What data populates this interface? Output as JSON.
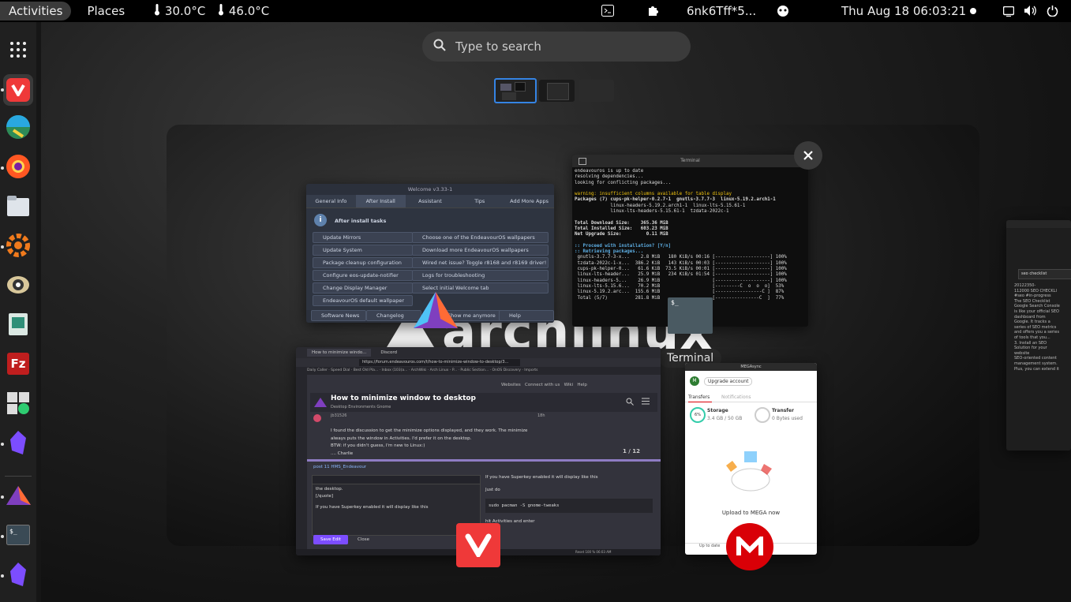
{
  "topbar": {
    "activities": "Activities",
    "places": "Places",
    "temp1": "30.0°C",
    "temp2": "46.0°C",
    "window_title": "6nk6Tff*5...",
    "datetime": "Thu Aug 18  06:03:21"
  },
  "search": {
    "placeholder": "Type to search"
  },
  "icons": [
    "apps-grid-icon",
    "vivaldi-icon",
    "kvantum-icon",
    "firefox-icon",
    "files-icon",
    "settings-icon",
    "eye-icon",
    "notes-icon",
    "filezilla-icon",
    "calculator-icon",
    "obsidian-icon",
    "endeavour-icon",
    "terminal-icon",
    "obsidian-icon"
  ],
  "windows": {
    "terminal_label": "Terminal",
    "terminal": {
      "title": "Terminal",
      "lines": [
        "endeavouros is up to date",
        "resolving dependencies...",
        "looking for conflicting packages...",
        "",
        "warning: insufficient columns available for table display",
        "Packages (7) cups-pk-helper-0.2.7-1  gnutls-3.7.7-3  linux-5.19.2.arch1-1",
        "             linux-headers-5.19.2.arch1-1  linux-lts-5.15.61-1",
        "             linux-lts-headers-5.15.61-1  tzdata-2022c-1",
        "",
        "Total Download Size:    365.36 MiB",
        "Total Installed Size:   603.23 MiB",
        "Net Upgrade Size:         0.11 MiB",
        "",
        ":: Proceed with installation? [Y/n]",
        ":: Retrieving packages...",
        " gnutls-3.7.7-3-x...    2.8 MiB   180 KiB/s 00:16 [--------------------] 100%",
        " tzdata-2022c-1-x...  386.2 KiB   143 KiB/s 00:03 [--------------------] 100%",
        " cups-pk-helper-0...   61.6 KiB  73.5 KiB/s 00:01 [--------------------] 100%",
        " linux-lts-header...   25.9 MiB   234 KiB/s 01:54 [--------------------] 100%",
        " linux-headers-5...    26.9 MiB                   [--------------------] 100%",
        " linux-lts-5.15.6...   70.2 MiB                   [---------C  o  o  o]  53%",
        " linux-5.19.2.arc...  155.6 MiB                   [-----------------C ]  87%",
        " Total (5/7)          281.8 MiB                   [----------------C  ]  77%"
      ]
    },
    "welcome": {
      "title": "Welcome v3.33-1",
      "tabs": [
        "General Info",
        "After Install",
        "Assistant",
        "Tips",
        "Add More Apps"
      ],
      "heading": "After install tasks",
      "left_buttons": [
        "Update Mirrors",
        "Update System",
        "Package cleanup configuration",
        "Configure eos-update-notifier",
        "Change Display Manager",
        "EndeavourOS default wallpaper"
      ],
      "right_buttons": [
        "Choose one of the EndeavourOS wallpapers",
        "Download more EndeavourOS wallpapers",
        "Wired net issue? Toggle r8168 and r8169 driver!",
        "Logs for troubleshooting",
        "Select initial Welcome tab"
      ],
      "footer": [
        "Software News",
        "Changelog",
        "Show me anymore",
        "Help"
      ]
    },
    "browser": {
      "tab1": "How to minimize windo...",
      "tab2": "Discord",
      "url": "https://forum.endeavouros.com/t/how-to-minimize-window-to-desktop/3...",
      "bookmarks": [
        "Daily Caller",
        "Speed Dial",
        "Best Old Pla...",
        "Inbox (103)a...",
        "ArchWiki",
        "Arch Linux - P...",
        "Public Section...",
        "OnOS Discovery",
        "Imports"
      ],
      "topic_title": "How to minimize window to desktop",
      "crumb": "Desktop Environments  Gnome",
      "author": "jb31526",
      "age": "18h",
      "post_lines": [
        "I found the discussion to get the minimize options displayed, and they work. The minimize",
        "always puts the window in Activities. I'd prefer it on the desktop.",
        "BTW: if you didn't guess, I'm new to Linux:)",
        ".... Charlie"
      ],
      "progress": "1 / 12",
      "reply_to": "post 11   HMS_Endeavour",
      "editor_text": [
        "the desktop.",
        "[/quote]",
        "",
        "If you have Superkey enabled it will display like this"
      ],
      "preview_lines": [
        "If you have Superkey enabled it will display like this",
        "Just do"
      ],
      "code": "sudo pacman -S gnome-tweaks",
      "after_code": "hit Activities and enter",
      "save": "Save Edit",
      "close": "Close",
      "nav": [
        "Websites",
        "Connect with us",
        "Wiki",
        "Help"
      ],
      "status_right": "Reset   100 %   06:03 AM"
    },
    "mega": {
      "title": "MEGAsync",
      "upgrade": "Upgrade account",
      "tabs": [
        "Transfers",
        "Notifications"
      ],
      "storage_pct": "6%",
      "storage_label": "Storage",
      "storage_value": "3.4 GB / 50 GB",
      "transfer_label": "Transfer",
      "transfer_value": "0 Bytes used",
      "upload_text": "Upload to MEGA now",
      "status": "Up to date"
    },
    "side": {
      "search": "seo checklist",
      "lines": [
        "20122350-",
        "112000 SEO CHECKLI",
        "#seo #in-progress",
        "The SEO Checklist",
        "Google Search Console",
        "is like your official SEO",
        "dashboard from",
        "Google. It tracks a",
        "series of SEO metrics",
        "and offers you a series",
        "of tools that you...",
        "3. Install an SEO",
        "Solution for your",
        "website",
        "SEO-oriented content",
        "management system.",
        "Plus, you can extend it"
      ]
    }
  },
  "colors": {
    "accent": "#3584e4",
    "topbar": "#000000",
    "dash": "#202020"
  }
}
